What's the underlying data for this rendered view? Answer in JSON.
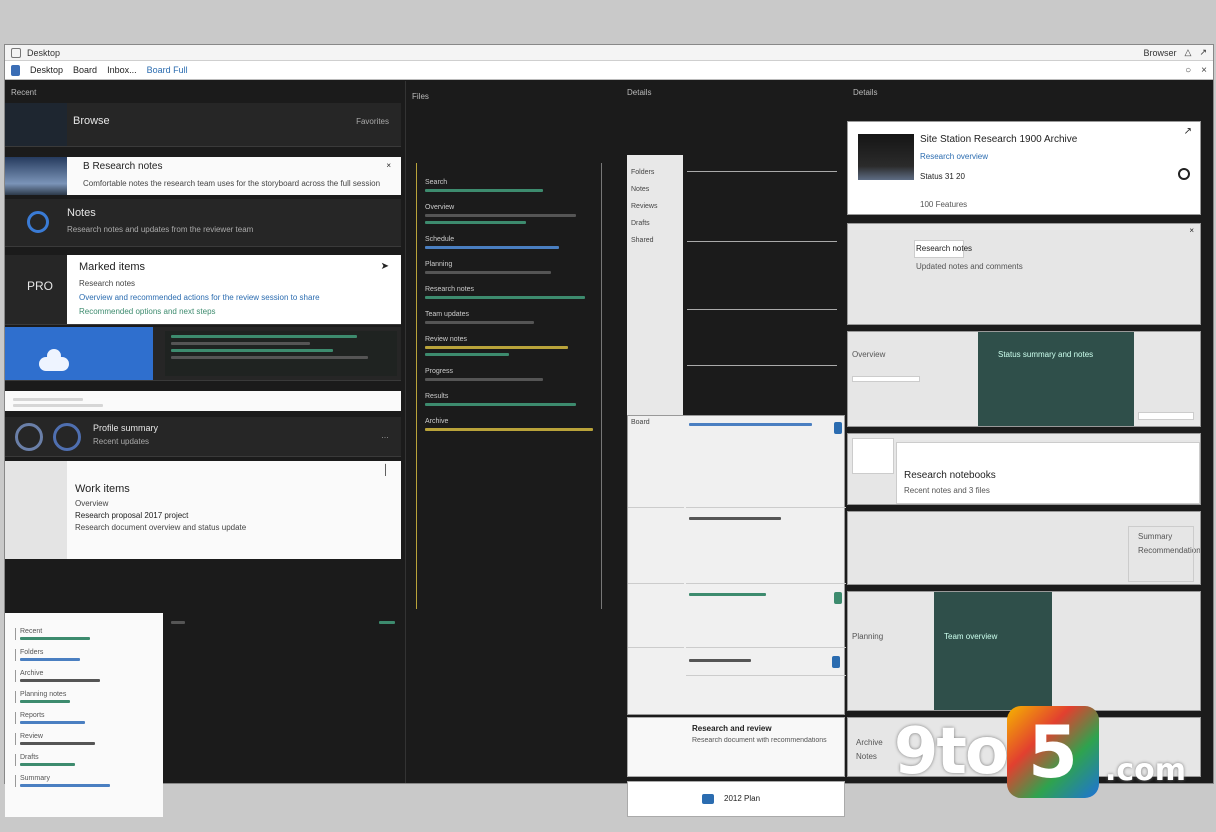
{
  "window": {
    "title": "Desktop",
    "right_label": "Browser"
  },
  "toolbar": {
    "app": "Desktop",
    "view": "Board",
    "nav": "Inbox...",
    "link": "Board Full"
  },
  "col1": {
    "head": "Recent",
    "cards": [
      {
        "title": "Browse",
        "meta": "Favorites"
      },
      {
        "title": "B Research notes",
        "sub": "Comfortable notes the research team uses for the storyboard across the full session"
      },
      {
        "title": "Notes",
        "sub": "Research notes and updates from the reviewer team"
      },
      {
        "badge": "PRO",
        "title": "Marked items",
        "sub": "Research notes",
        "desc": "Overview and recommended actions for the review session to share",
        "accent": "Recommended options and next steps"
      },
      {
        "title": "Profile summary",
        "sub": "Recent updates"
      },
      {
        "title": "Work items",
        "sub": "Overview",
        "line1": "Research proposal 2017 project",
        "line2": "Research document overview and status update"
      }
    ],
    "tree_items": [
      "Recent",
      "Folders",
      "Archive",
      "Planning notes",
      "Reports",
      "Review",
      "Drafts",
      "Summary"
    ]
  },
  "col2": {
    "head": "Files",
    "items": [
      "Search",
      "Overview",
      "Schedule",
      "Planning",
      "Research notes",
      "Team updates",
      "Review notes",
      "Progress",
      "Results",
      "Archive"
    ]
  },
  "col3": {
    "head": "Details",
    "list": [
      "Folders",
      "Notes",
      "Reviews",
      "Drafts",
      "Shared"
    ],
    "grid_label": "Board",
    "msg_title": "Research and review",
    "msg_sub": "Research document with recommendations",
    "bottom_label": "2012 Plan"
  },
  "col4": {
    "head": "Details",
    "feature": {
      "title": "Site Station Research 1900 Archive",
      "accent": "Research overview",
      "sub": "Status 31 20",
      "meta": "100 Features"
    },
    "cards": [
      {
        "title": "Research notes",
        "sub": "Updated notes and comments"
      },
      {
        "title": "Overview",
        "sub": "Status summary and notes"
      },
      {
        "title": "Research notebooks",
        "sub": "Recent notes and 3 files"
      },
      {
        "title": "Summary",
        "sub": "Recommendations"
      },
      {
        "title": "Planning",
        "sub": "Team overview"
      },
      {
        "title": "Archive",
        "sub": "Notes"
      }
    ]
  },
  "watermark": {
    "brand": "9to",
    "digit": "5",
    "suffix": ".com"
  }
}
